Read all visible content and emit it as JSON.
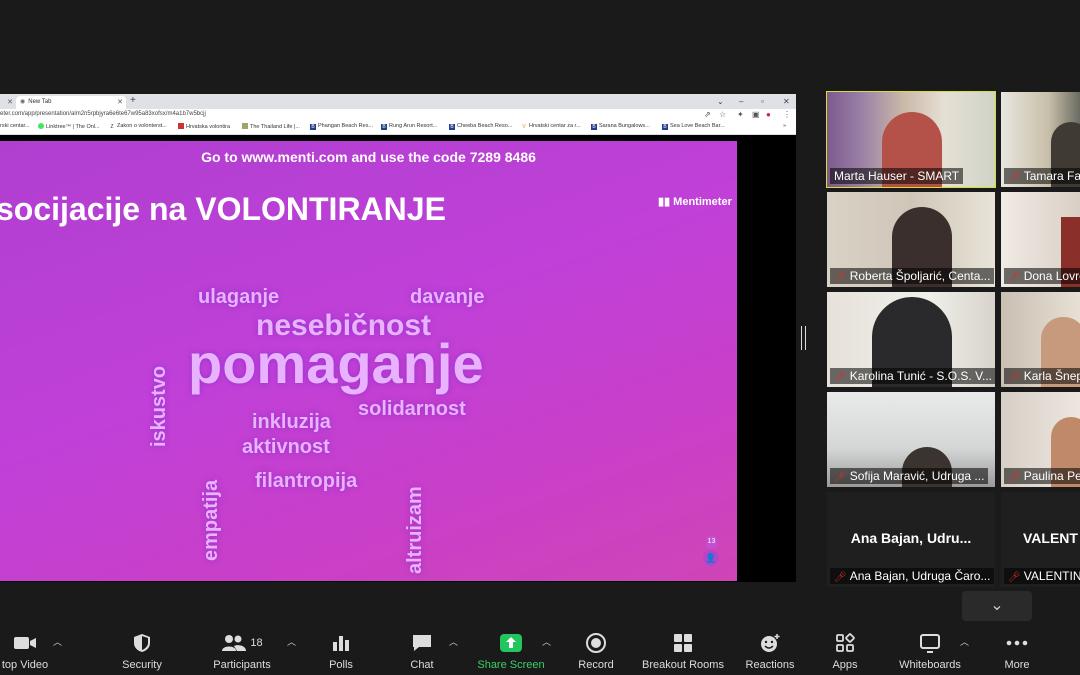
{
  "browser": {
    "tabs": [
      {
        "label": ""
      },
      {
        "label": "New Tab"
      }
    ],
    "url": "eter.com/app/presentation/alm2n5rpbjyra6e6te67w95a83xofsx/m4a1b7w5bcjj",
    "bookmarks": [
      {
        "label": "rski centar...",
        "icon": "doc"
      },
      {
        "label": "Linktree™ | The Onl...",
        "icon": "linktree"
      },
      {
        "label": "Zakon o volonterst...",
        "icon": "z"
      },
      {
        "label": "Hrvatska volontira",
        "icon": "hv"
      },
      {
        "label": "The Thailand Life |...",
        "icon": "tl"
      },
      {
        "label": "Phangan Beach Res...",
        "icon": "b"
      },
      {
        "label": "Rung Arun Resort...",
        "icon": "b"
      },
      {
        "label": "Cheeba Beach Reso...",
        "icon": "b"
      },
      {
        "label": "Hrvatski centar za r...",
        "icon": "v"
      },
      {
        "label": "Sarana Bungalows...",
        "icon": "b"
      },
      {
        "label": "Sea Love Beach Bar...",
        "icon": "b"
      }
    ]
  },
  "slide": {
    "code_prefix": "Go to ",
    "code_site": "www.menti.com",
    "code_mid": " and use the code ",
    "code_value": "7289 8486",
    "title": "socijacije na VOLONTIRANJE",
    "logo": "Mentimeter",
    "counter": "13",
    "words": [
      {
        "text": "ulaganje",
        "weight": 2
      },
      {
        "text": "davanje",
        "weight": 2
      },
      {
        "text": "nesebičnost",
        "weight": 3
      },
      {
        "text": "pomaganje",
        "weight": 5
      },
      {
        "text": "iskustvo",
        "weight": 2
      },
      {
        "text": "solidarnost",
        "weight": 2
      },
      {
        "text": "inkluzija",
        "weight": 2
      },
      {
        "text": "aktivnost",
        "weight": 2
      },
      {
        "text": "empatija",
        "weight": 2
      },
      {
        "text": "filantropija",
        "weight": 2
      },
      {
        "text": "altruizam",
        "weight": 2
      }
    ]
  },
  "participants": [
    {
      "name": "Marta Hauser - SMART",
      "muted": false
    },
    {
      "name": "Tamara Fal",
      "muted": true
    },
    {
      "name": "Roberta Špoljarić, Centa...",
      "muted": true
    },
    {
      "name": "Dona Lovre",
      "muted": true
    },
    {
      "name": "Karolina Tunić - S.O.S. V...",
      "muted": true
    },
    {
      "name": "Karla Šnep",
      "muted": true
    },
    {
      "name": "Sofija Maravić, Udruga ...",
      "muted": true
    },
    {
      "name": "Paulina Per",
      "muted": true
    },
    {
      "name": "Ana Bajan, Udruga Čaro...",
      "muted": true,
      "display": "Ana Bajan, Udru..."
    },
    {
      "name": "VALENTINA",
      "muted": true,
      "display": "VALENT"
    }
  ],
  "toolbar": {
    "stop_video": "top Video",
    "security": "Security",
    "participants": "Participants",
    "participants_count": "18",
    "polls": "Polls",
    "chat": "Chat",
    "share_screen": "Share Screen",
    "record": "Record",
    "breakout_rooms": "Breakout Rooms",
    "reactions": "Reactions",
    "apps": "Apps",
    "whiteboards": "Whiteboards",
    "more": "More"
  },
  "colors": {
    "share_green": "#22c55e",
    "speaker_outline": "#d7df34",
    "slide": "#c040d8"
  }
}
